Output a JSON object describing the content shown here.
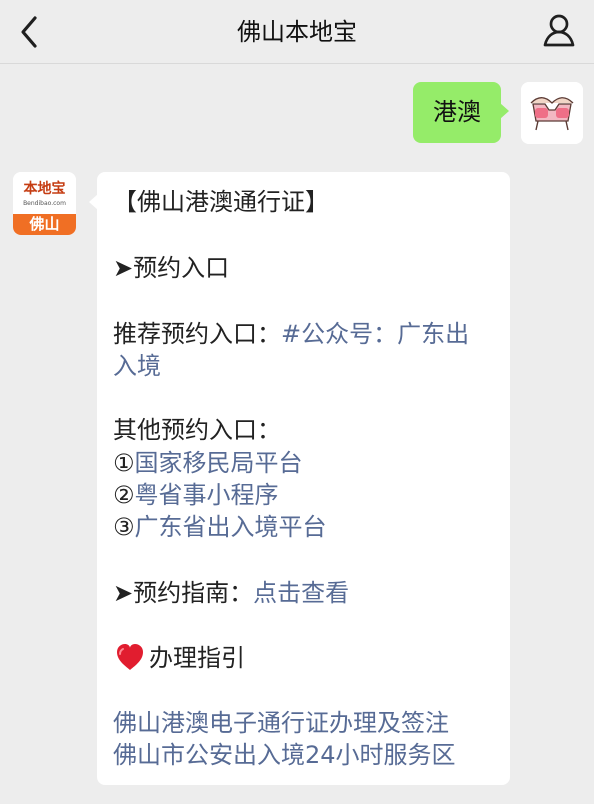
{
  "header": {
    "title": "佛山本地宝"
  },
  "user_message": {
    "text": "港澳"
  },
  "bot_avatar": {
    "brand_text_top": "本地宝",
    "brand_text_sub": "Bendibao.com",
    "brand_text_city": "佛山"
  },
  "message": {
    "title": "【佛山港澳通行证】",
    "section_appointment": "➤预约入口",
    "recommended_prefix": "推荐预约入口：",
    "recommended_link_line1": "#公众号：广东出",
    "recommended_link_line2": "入境",
    "other_label": "其他预约入口：",
    "other_items": [
      {
        "marker": "①",
        "label": "国家移民局平台"
      },
      {
        "marker": "②",
        "label": "粤省事小程序"
      },
      {
        "marker": "③",
        "label": "广东省出入境平台"
      }
    ],
    "guide_prefix": "➤预约指南：",
    "guide_link": "点击查看",
    "process_label": "办理指引",
    "bottom_link_1": "佛山港澳电子通行证办理及签注",
    "bottom_link_2": "佛山市公安出入境24小时服务区"
  },
  "colors": {
    "background": "#ededed",
    "self_bubble": "#95ec69",
    "other_bubble": "#ffffff",
    "link": "#576b95",
    "heart": "#e11d2f",
    "brand_orange": "#f06f24"
  },
  "icons": {
    "back": "back-icon",
    "profile": "profile-icon",
    "heart": "heart-icon"
  }
}
